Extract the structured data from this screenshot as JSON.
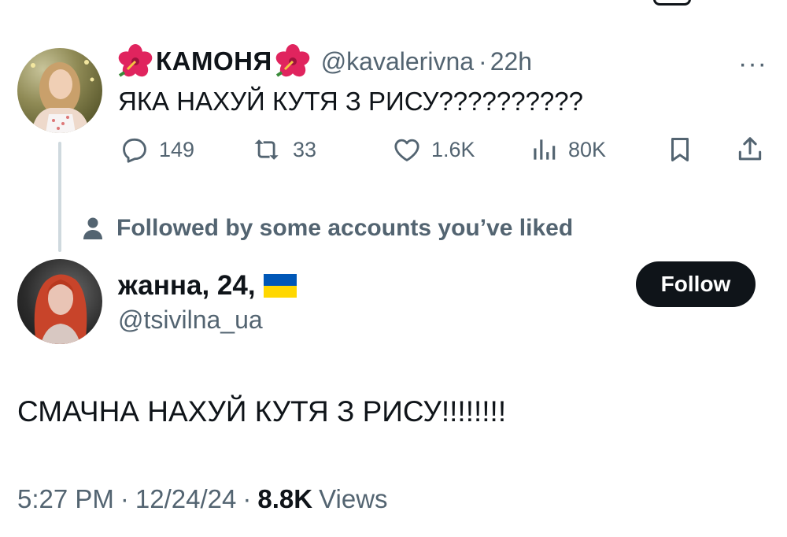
{
  "parent_tweet": {
    "display_name": "КАМОНЯ",
    "name_emoji_left": "hibiscus-flower",
    "name_emoji_right": "hibiscus-flower",
    "handle": "@kavalerivna",
    "separator": "·",
    "time": "22h",
    "more": "···",
    "text": "ЯКА НАХУЙ КУТЯ З РИСУ??????????",
    "replies": "149",
    "reposts": "33",
    "likes": "1.6K",
    "views": "80K"
  },
  "social_context": {
    "icon": "person-icon",
    "text": "Followed by some accounts you’ve liked"
  },
  "main_tweet": {
    "display_name": "жанна, 24,",
    "flag": "ukraine-flag",
    "handle": "@tsivilna_ua",
    "follow_label": "Follow",
    "text": "СМАЧНА НАХУЙ КУТЯ З РИСУ!!!!!!!!",
    "time": "5:27 PM",
    "sep1": "·",
    "date": "12/24/24",
    "sep2": "·",
    "views_count": "8.8K",
    "views_label": "Views"
  },
  "colors": {
    "text": "#0f1419",
    "secondary": "#536471",
    "follow_bg": "#0f1419",
    "flag_blue": "#0057b7",
    "flag_yellow": "#ffd700"
  }
}
